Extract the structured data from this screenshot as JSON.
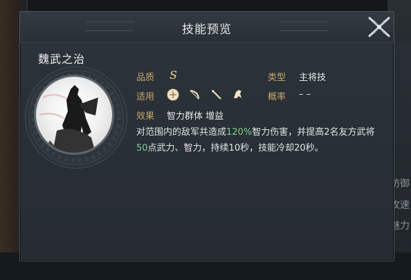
{
  "dialog": {
    "title": "技能预览"
  },
  "skill": {
    "name": "魏武之治",
    "quality_label": "品质",
    "quality_value": "S",
    "type_label": "类型",
    "type_value": "主将技",
    "apply_label": "适用",
    "apply_icons": [
      "shield-unit-icon",
      "bow-unit-icon",
      "spear-unit-icon",
      "cavalry-unit-icon"
    ],
    "chance_label": "概率",
    "chance_value": "– –",
    "effect_label": "效果",
    "effect_tags": "智力群体 增益",
    "description_parts": [
      {
        "text": "对范围内的敌军共造成",
        "hl": false
      },
      {
        "text": "120%",
        "hl": true
      },
      {
        "text": "智力伤害，并提高2名友方武将",
        "hl": false
      },
      {
        "text": "50",
        "hl": true
      },
      {
        "text": "点武力、智力，持续10秒，技能冷却20秒。",
        "hl": false
      }
    ]
  },
  "background": {
    "right_labels": [
      "防御",
      "攻速",
      "魅力"
    ]
  },
  "colors": {
    "highlight": "#7fd08a",
    "label": "#c8a770",
    "quality": "#f5d98a"
  }
}
